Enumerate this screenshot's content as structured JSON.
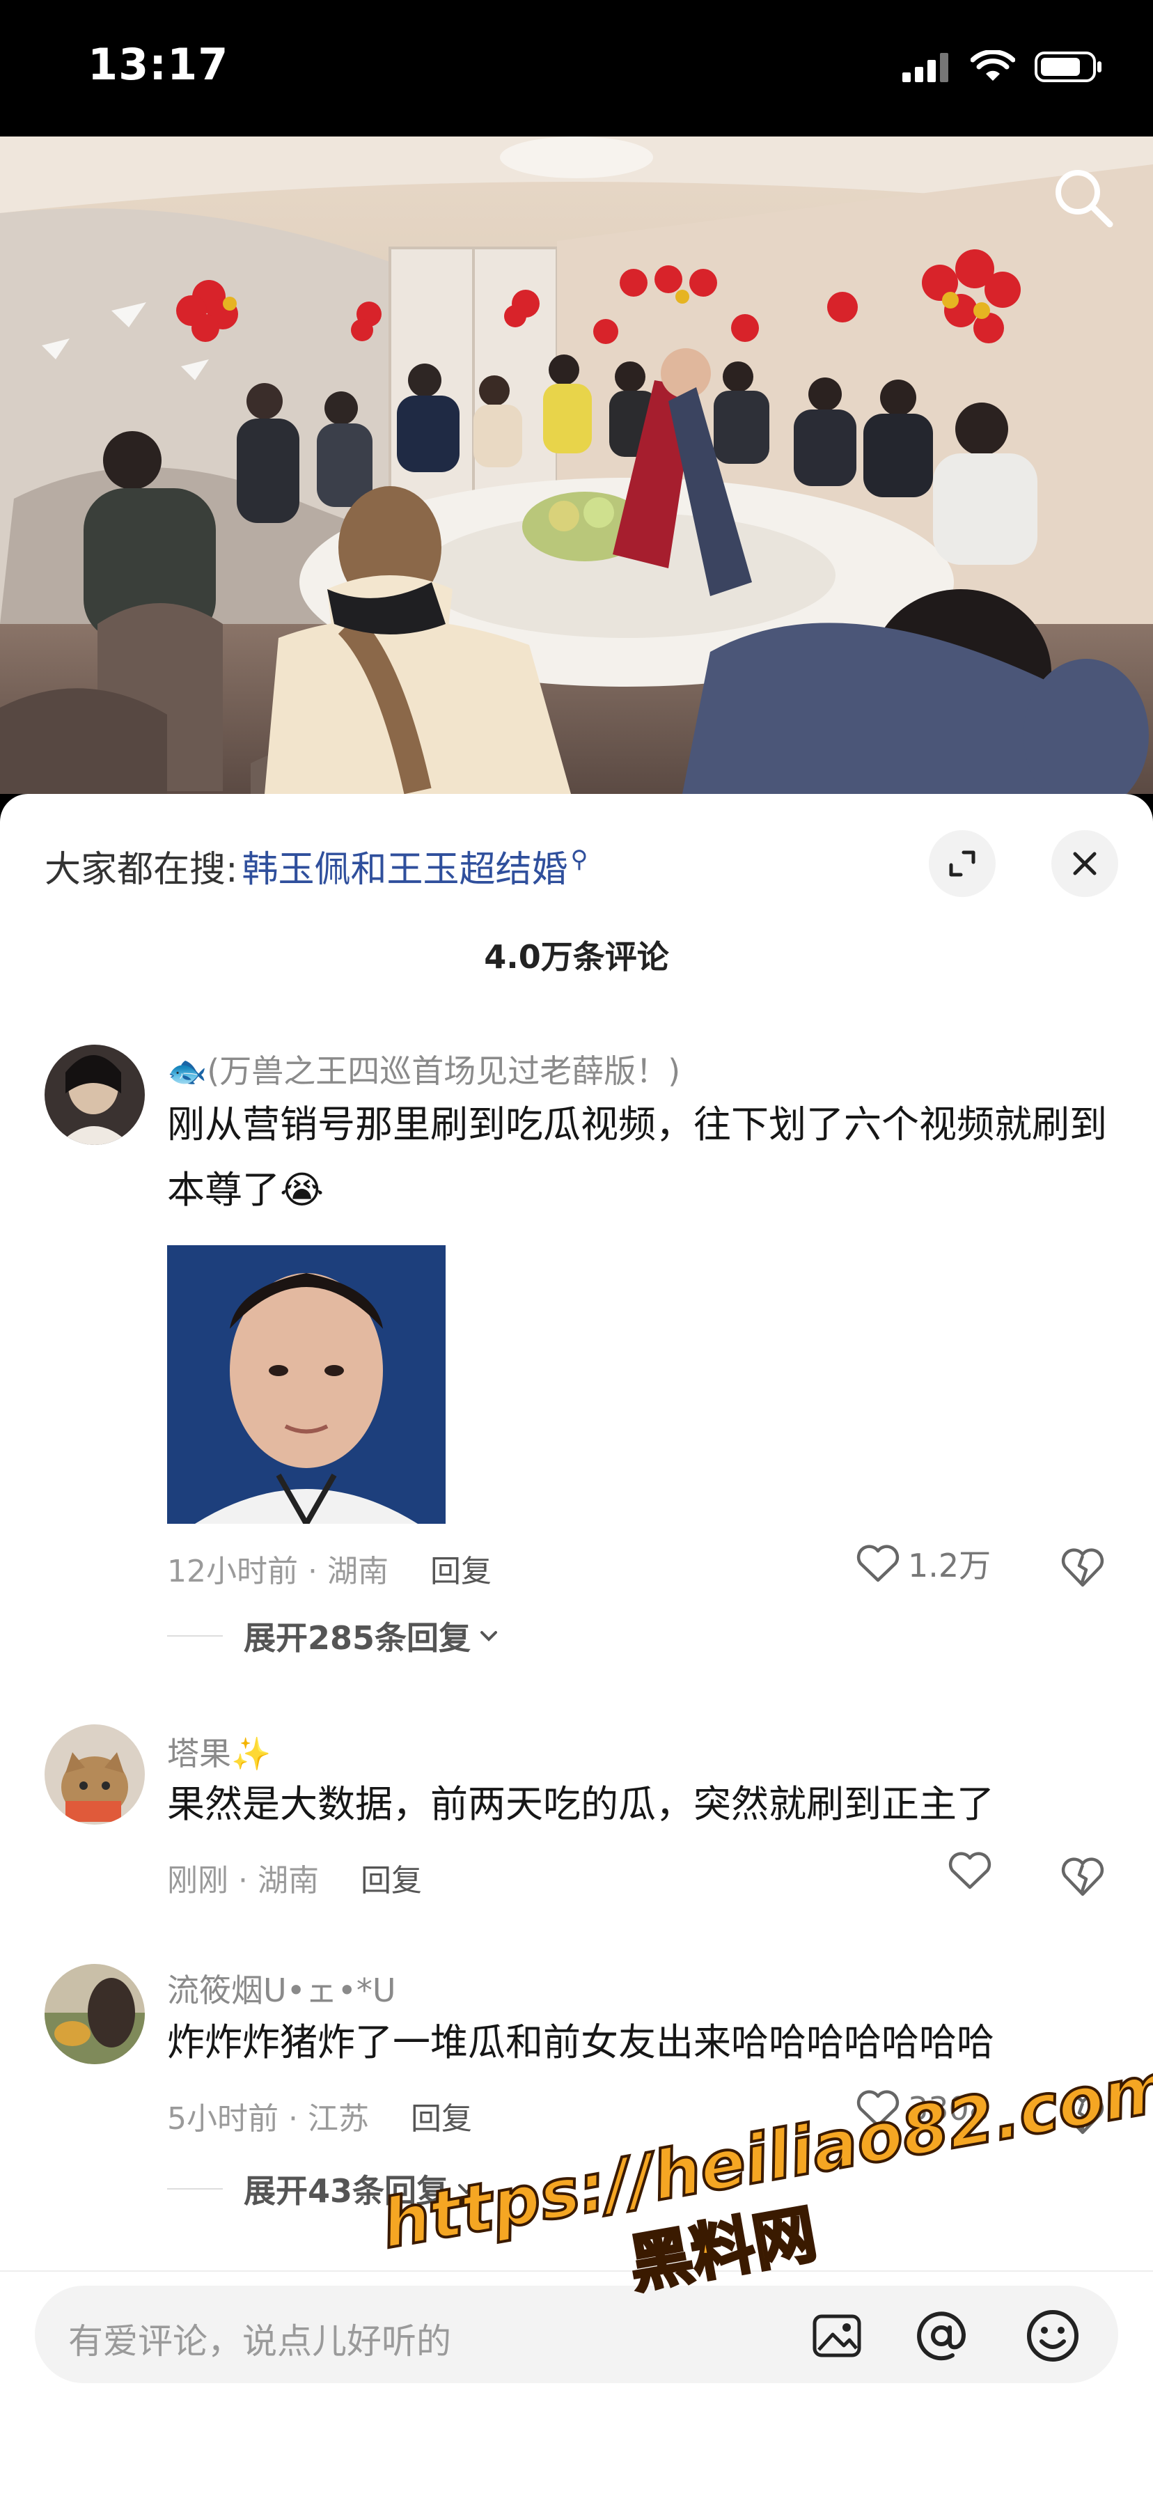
{
  "status": {
    "time": "13:17"
  },
  "sheet": {
    "hot_search_prefix": "大家都在搜:",
    "hot_search_query": "韩玉佩和王玉超结婚",
    "comment_count": "4.0万条评论"
  },
  "comments": [
    {
      "username": "🐟(万兽之王四巡首场见过老薛版！)",
      "text": "刚从营销号那里刷到吃瓜视频，往下划了六个视频就刷到本尊了😭",
      "meta": "12小时前 · 湖南",
      "reply": "回复",
      "likes": "1.2万",
      "expand": "展开285条回复"
    },
    {
      "username": "塔果✨",
      "text": "果然是大数据，前两天吃的瓜，突然就刷到正主了",
      "meta": "刚刚 · 湖南",
      "reply": "回复",
      "likes": ""
    },
    {
      "username": "流筱烟U•ェ•*U",
      "text": "炸炸炸猪炸了一堆瓜和前女友出来哈哈哈哈哈哈哈",
      "meta": "5小时前 · 江苏",
      "reply": "回复",
      "likes": "3308",
      "expand": "展开43条回复"
    }
  ],
  "input": {
    "placeholder": "有爱评论，说点儿好听的"
  },
  "watermark": {
    "url": "https://heiliao82.com",
    "name": "黑料网"
  },
  "icons": [
    "signal-icon",
    "wifi-icon",
    "battery-icon",
    "search-icon",
    "expand-icon",
    "close-icon",
    "heart-icon",
    "broken-heart-icon",
    "image-icon",
    "at-icon",
    "emoji-icon",
    "chevron-down-icon"
  ],
  "colors": {
    "link": "#2f4f9c",
    "accent_watermark": "#f5a623"
  }
}
